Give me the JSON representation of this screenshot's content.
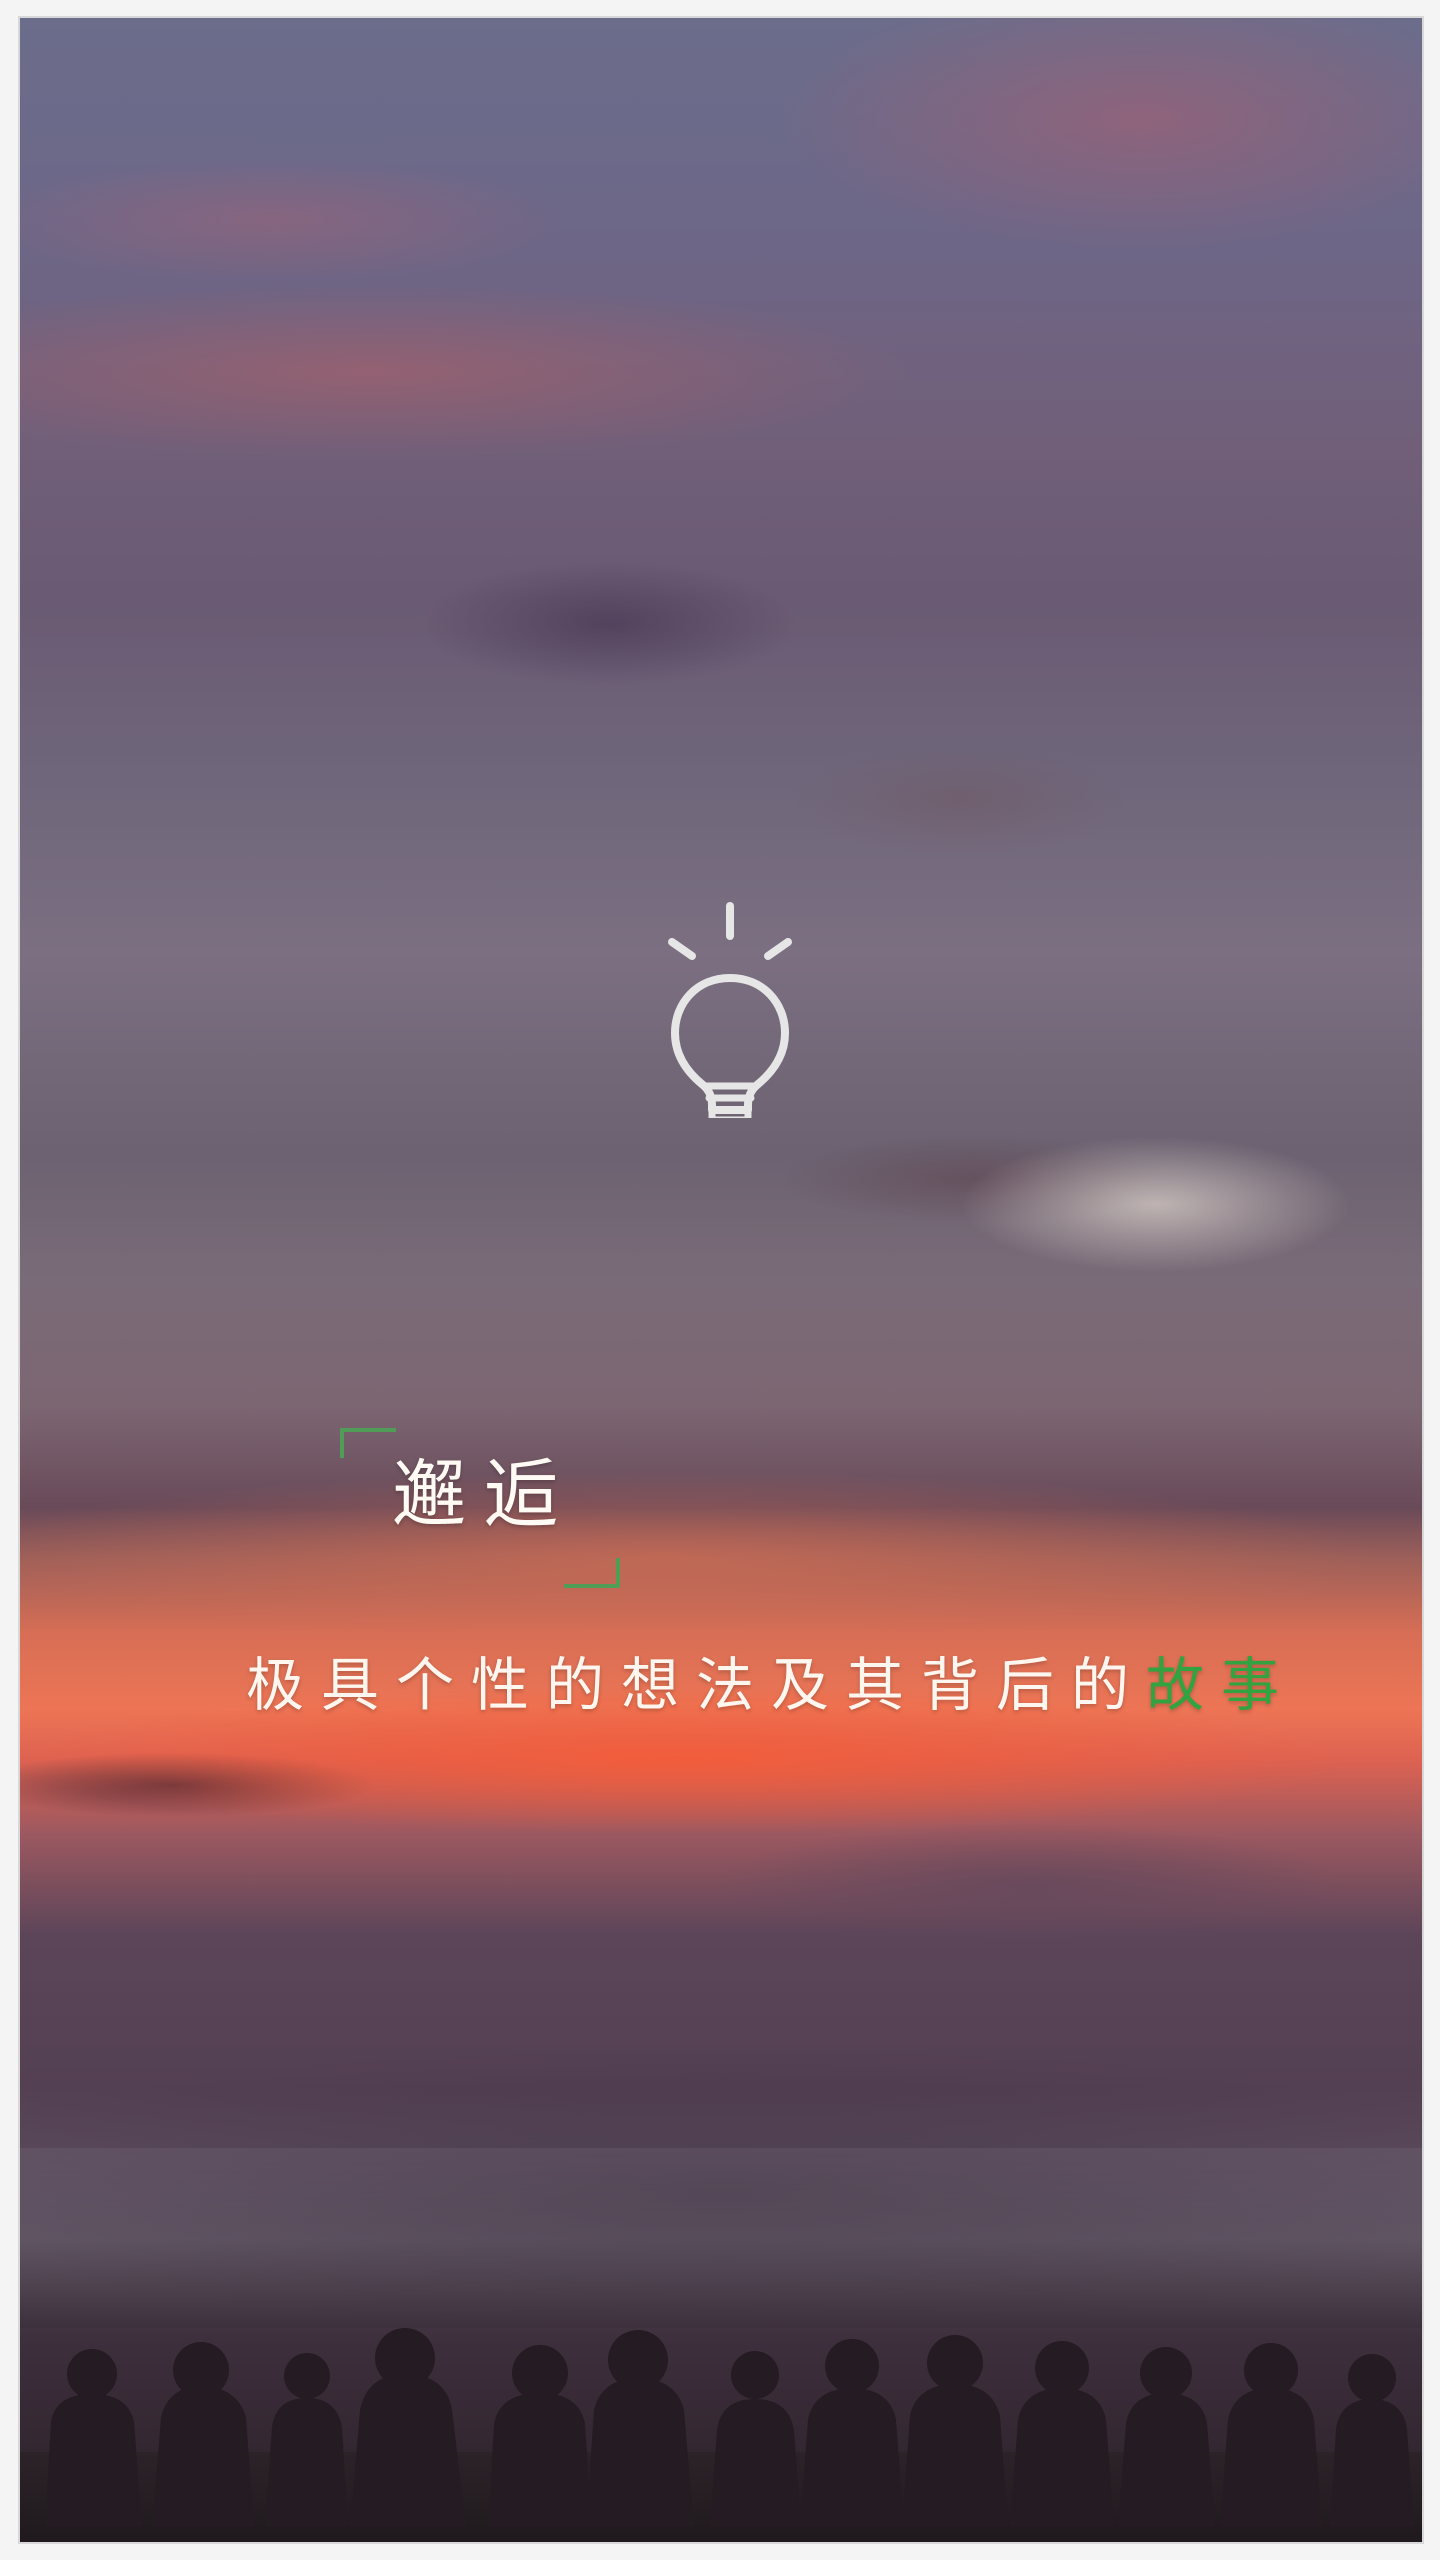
{
  "app": {
    "title": "邂逅"
  },
  "hero": {
    "tagline_main": "极具个性的想法及其背后的",
    "tagline_highlight": "故事"
  },
  "icons": {
    "primary": "lightbulb-icon"
  },
  "colors": {
    "accent_green": "#4f9d56",
    "highlight_green": "#31a340",
    "text_light": "#fff7ef"
  }
}
